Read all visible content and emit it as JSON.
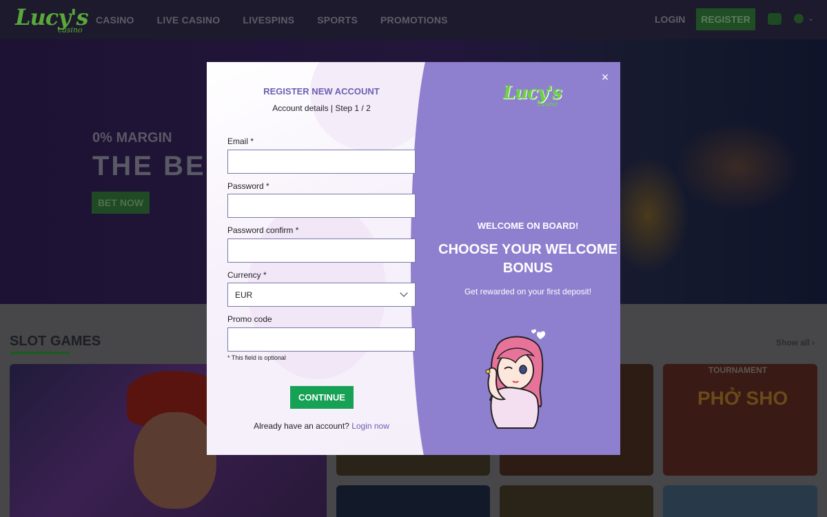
{
  "nav": {
    "logo_word": "Lucy's",
    "logo_sub": "casino",
    "items": [
      "CASINO",
      "LIVE CASINO",
      "LIVESPINS",
      "SPORTS",
      "PROMOTIONS"
    ],
    "login": "LOGIN",
    "register": "REGISTER"
  },
  "hero": {
    "margin": "0% MARGIN",
    "headline": "THE BES",
    "cta": "BET NOW"
  },
  "slots": {
    "title": "SLOT GAMES",
    "show_all": "Show all",
    "pho_sho": "PHỞ SHO",
    "tournament": "TOURNAMENT"
  },
  "modal": {
    "title": "REGISTER NEW ACCOUNT",
    "step": "Account details | Step 1 / 2",
    "email_label": "Email *",
    "password_label": "Password *",
    "password_confirm_label": "Password confirm *",
    "currency_label": "Currency *",
    "currency_value": "EUR",
    "promo_label": "Promo code",
    "optional_note": "* This field is optional",
    "continue": "CONTINUE",
    "already": "Already have an account?",
    "login_now": "Login now",
    "close": "×",
    "logo_word": "Lucy's",
    "logo_sub": "casino",
    "welcome": "WELCOME ON BOARD!",
    "choose_line1": "CHOOSE YOUR WELCOME",
    "choose_line2": "BONUS",
    "reward": "Get rewarded on your first deposit!"
  },
  "colors": {
    "accent_purple": "#8f80cf",
    "title_purple": "#6a5fb3",
    "green": "#16a155"
  }
}
